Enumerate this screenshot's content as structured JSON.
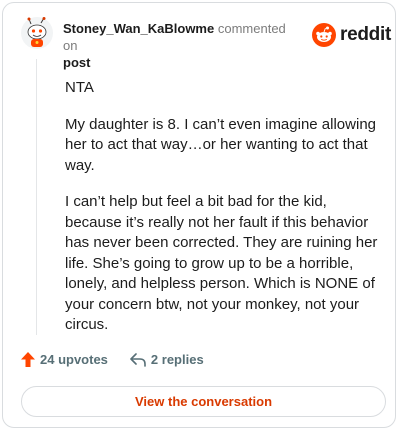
{
  "comment": {
    "author": "Stoney_Wan_KaBlowme",
    "meta_text": "commented on",
    "post_link": "post",
    "paragraphs": [
      "NTA",
      "My daughter is 8. I can’t even imagine allowing her to act that way…or her wanting to act that way.",
      "I can’t help but feel a bit bad for the kid, because it’s really not her fault if this behavior has never been corrected. They are ruining her life. She’s going to grow up to be a horrible, lonely, and helpless person. Which is NONE of your concern btw, not your monkey, not your circus."
    ]
  },
  "brand": {
    "name": "reddit",
    "icon": "reddit-snoo-icon",
    "color": "#ff4500"
  },
  "actions": {
    "upvotes": "24 upvotes",
    "replies": "2 replies",
    "upvote_icon": "upvote-arrow-icon",
    "reply_icon": "reply-arrow-icon",
    "upvote_color": "#ff4500"
  },
  "cta": {
    "label": "View the conversation",
    "color": "#d93a00"
  }
}
